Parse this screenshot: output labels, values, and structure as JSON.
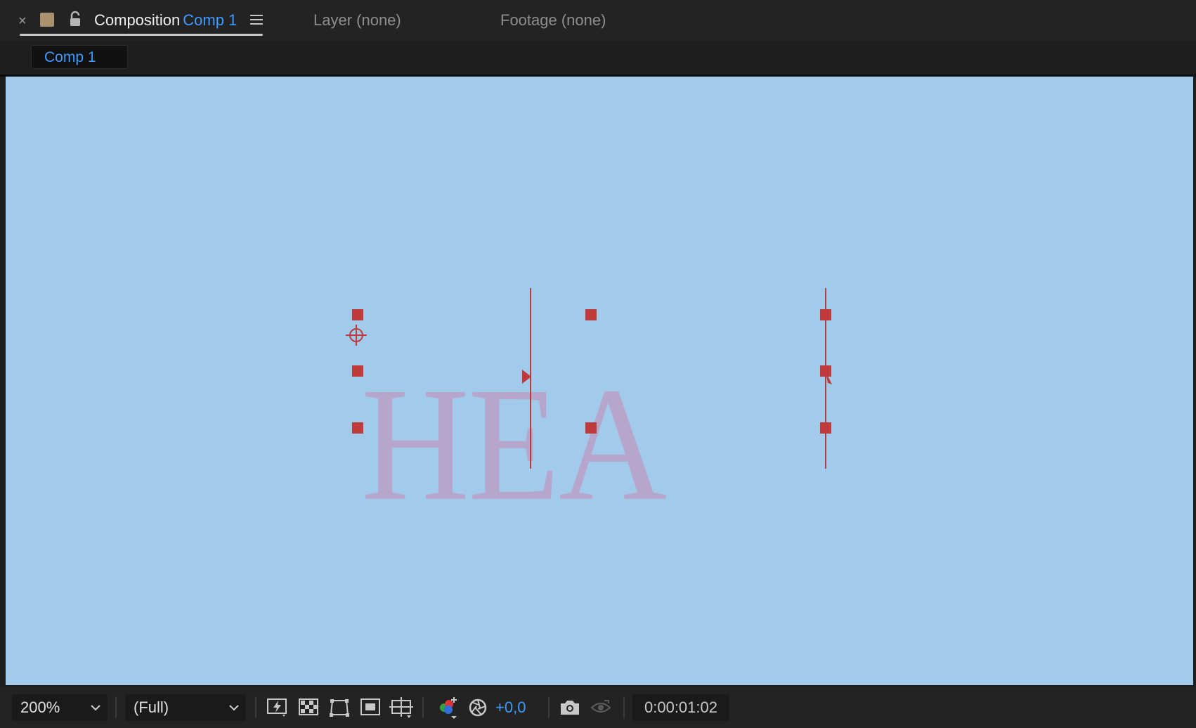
{
  "panel": {
    "close_glyph": "×",
    "label_color_swatch": "#a8926f",
    "title_prefix": "Composition",
    "comp_name": "Comp 1",
    "other_tabs": {
      "layer": "Layer (none)",
      "footage": "Footage (none)"
    }
  },
  "breadcrumb": {
    "comp": "Comp 1"
  },
  "viewer": {
    "background": "#a2cbeb",
    "layer_text": "HEA",
    "text_color": "#b7a6cc",
    "handle_color": "#c0393b"
  },
  "toolbar": {
    "magnification": "200%",
    "resolution": "(Full)",
    "exposure": "+0,0",
    "timecode": "0:00:01:02",
    "icons": [
      "fast-previews-icon",
      "transparency-grid-icon",
      "mask-visibility-icon",
      "region-of-interest-icon",
      "guides-grid-icon",
      "show-channel-icon",
      "reset-exposure-icon",
      "snapshot-icon",
      "show-snapshot-icon"
    ]
  }
}
